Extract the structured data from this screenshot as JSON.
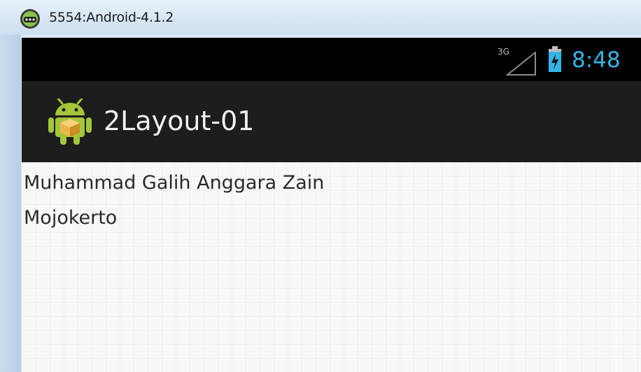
{
  "window": {
    "title": "5554:Android-4.1.2",
    "icon": "android-emulator-icon"
  },
  "statusbar": {
    "network_label": "3G",
    "signal_icon": "signal-icon",
    "battery_icon": "battery-charging-icon",
    "time": "8:48",
    "time_color": "#33b5e5"
  },
  "actionbar": {
    "app_icon": "android-app-icon",
    "title": "2Layout-01"
  },
  "content": {
    "texts": [
      "Muhammad Galih Anggara Zain",
      "Mojokerto"
    ]
  }
}
